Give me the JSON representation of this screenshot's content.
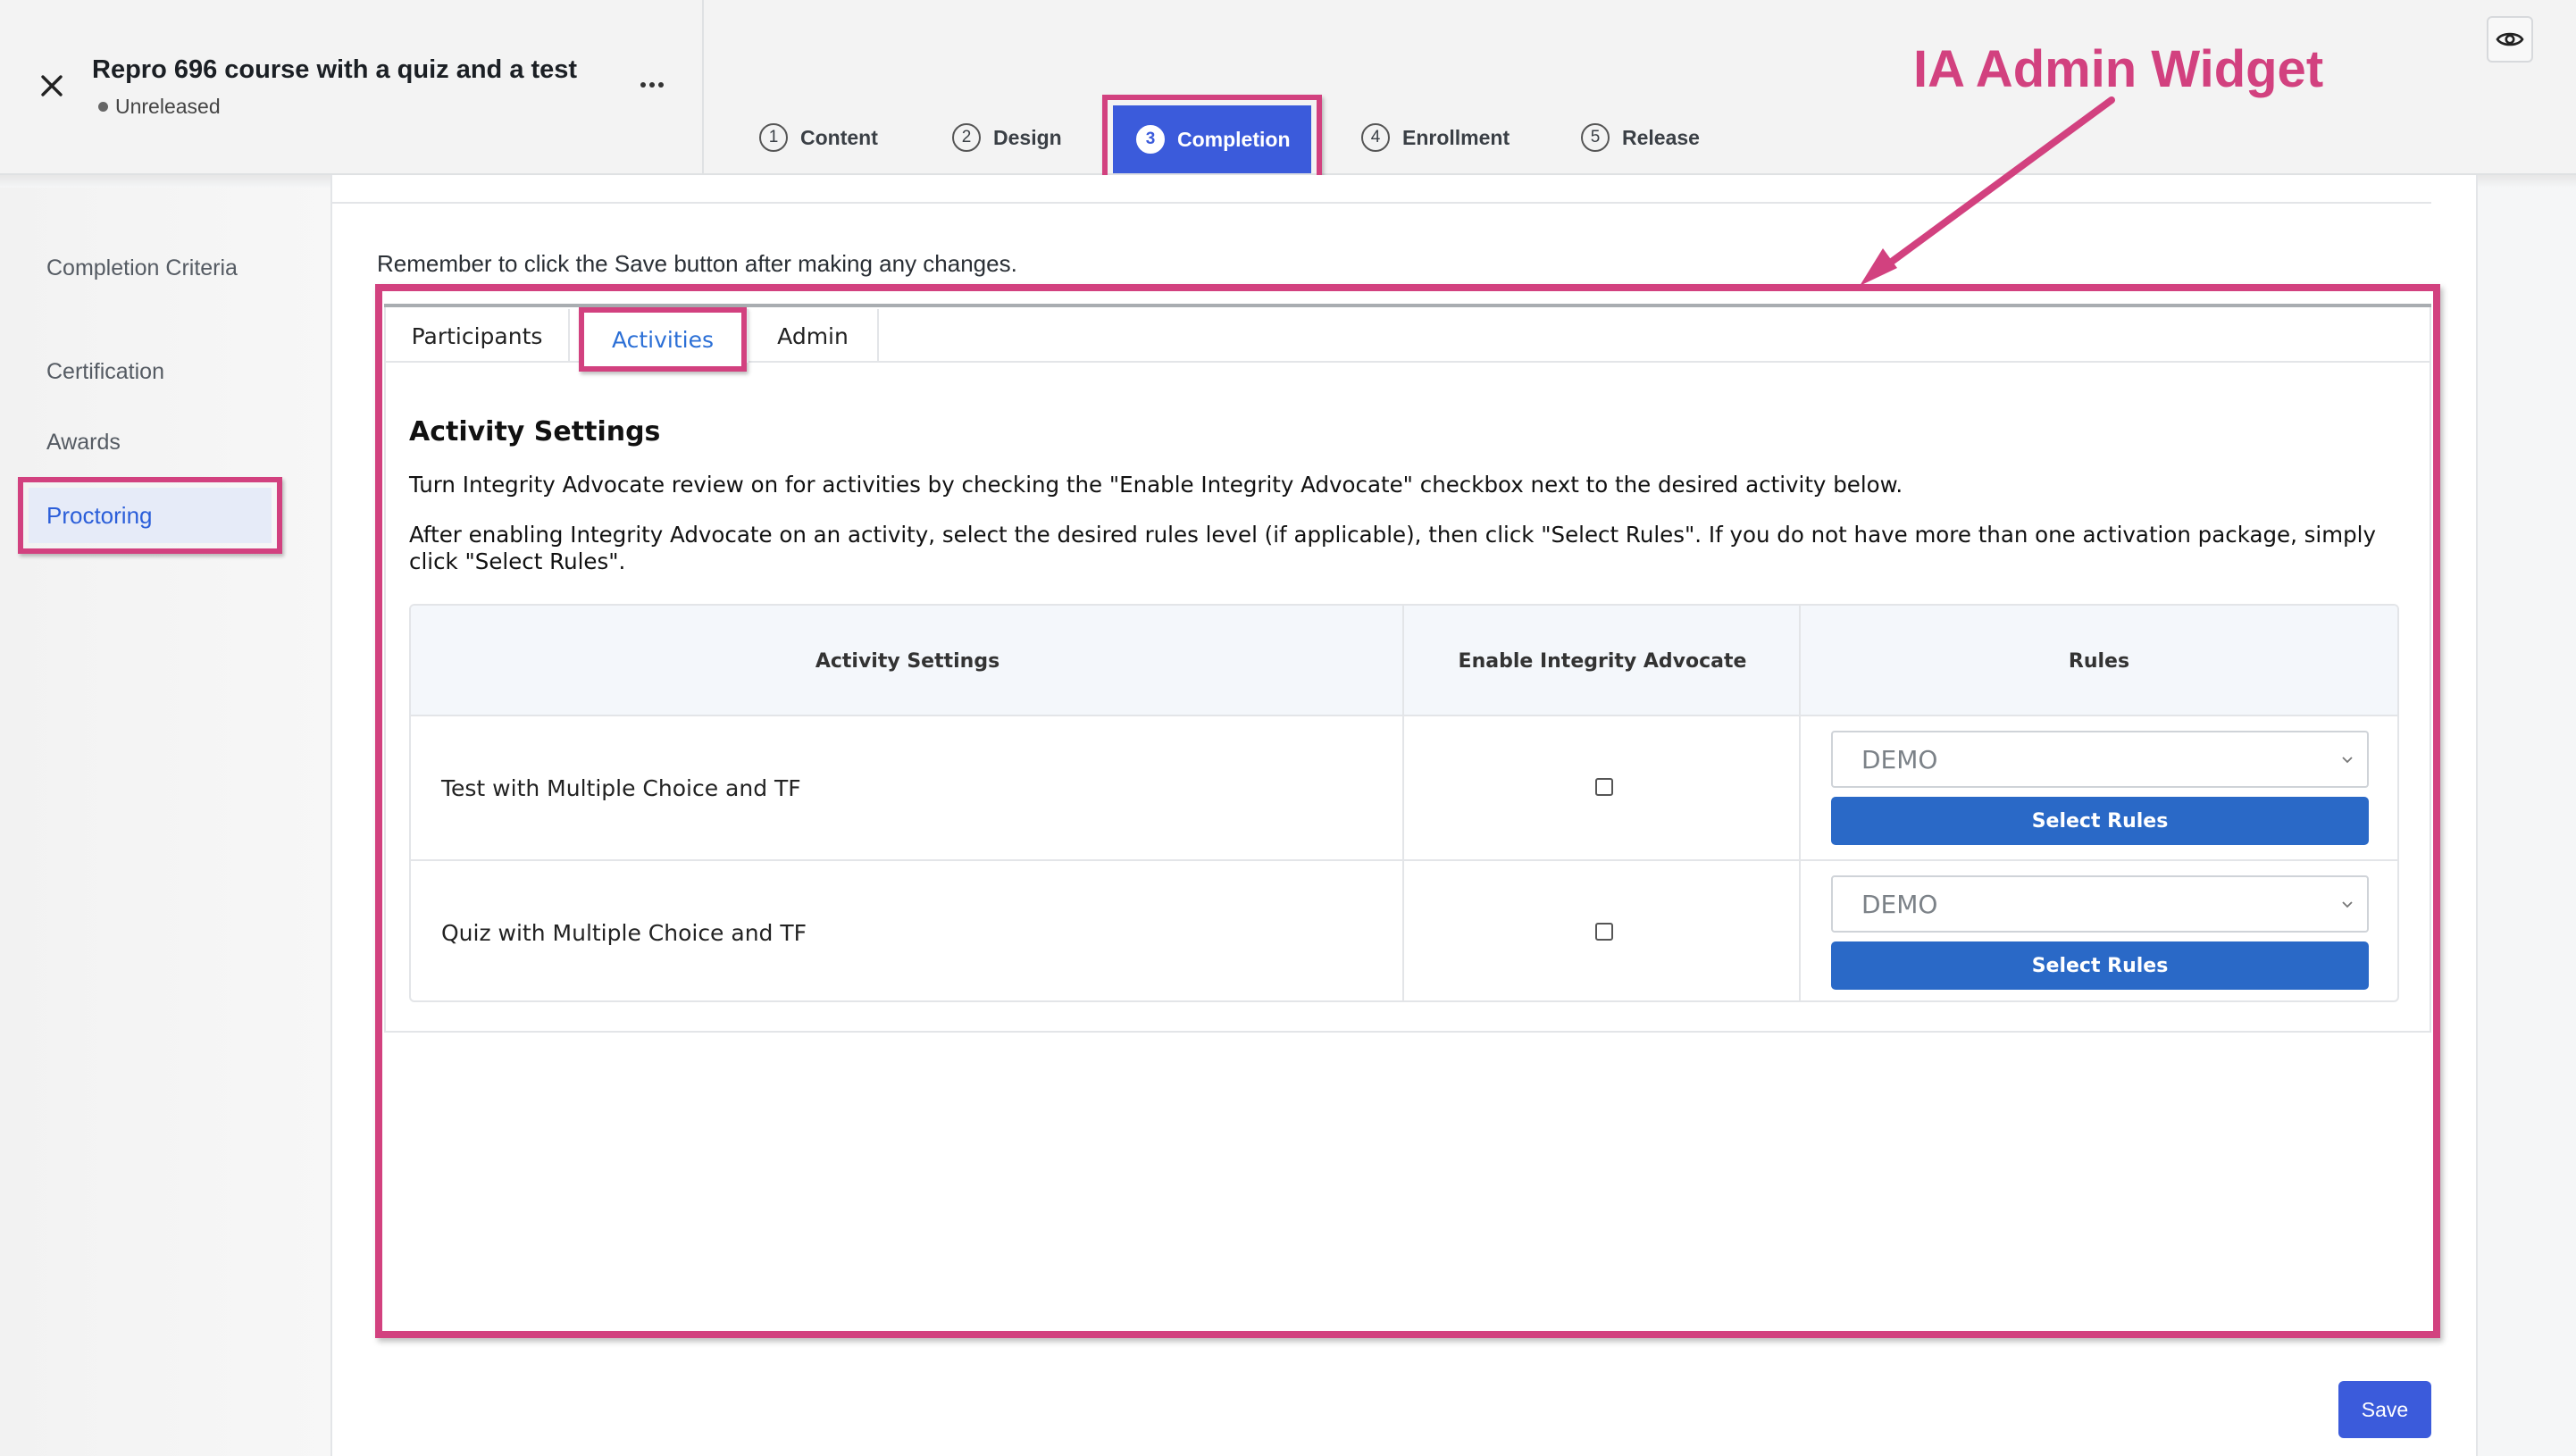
{
  "header": {
    "course_title": "Repro 696 course with a quiz and a test",
    "status": "Unreleased",
    "steps": [
      {
        "num": "1",
        "label": "Content"
      },
      {
        "num": "2",
        "label": "Design"
      },
      {
        "num": "3",
        "label": "Completion"
      },
      {
        "num": "4",
        "label": "Enrollment"
      },
      {
        "num": "5",
        "label": "Release"
      }
    ],
    "active_step": "Completion"
  },
  "annotation": {
    "title": "IA Admin Widget",
    "color": "#d2417f"
  },
  "sidebar": {
    "items": [
      {
        "label": "Completion Criteria"
      },
      {
        "label": "Certification"
      },
      {
        "label": "Awards"
      },
      {
        "label": "Proctoring"
      }
    ],
    "active_item": "Proctoring"
  },
  "main": {
    "reminder": "Remember to click the Save button after making any changes.",
    "tabs": [
      {
        "label": "Participants"
      },
      {
        "label": "Activities"
      },
      {
        "label": "Admin"
      }
    ],
    "active_tab": "Activities",
    "section_title": "Activity Settings",
    "paragraph_1": "Turn Integrity Advocate review on for activities by checking the \"Enable Integrity Advocate\" checkbox next to the desired activity below.",
    "paragraph_2": "After enabling Integrity Advocate on an activity, select the desired rules level (if applicable), then click \"Select Rules\". If you do not have more than one activation package, simply click \"Select Rules\".",
    "table": {
      "headers": [
        "Activity Settings",
        "Enable Integrity Advocate",
        "Rules"
      ],
      "rows": [
        {
          "name": "Test with Multiple Choice and TF",
          "enabled": false,
          "rules_value": "DEMO",
          "button": "Select Rules"
        },
        {
          "name": "Quiz with Multiple Choice and TF",
          "enabled": false,
          "rules_value": "DEMO",
          "button": "Select Rules"
        }
      ]
    },
    "save_label": "Save"
  },
  "colors": {
    "accent": "#3b5bdb",
    "button_blue": "#2a69c7",
    "highlight": "#d2417f"
  },
  "icons": [
    "close-icon",
    "more-icon",
    "eye-icon",
    "chevron-down-icon"
  ]
}
